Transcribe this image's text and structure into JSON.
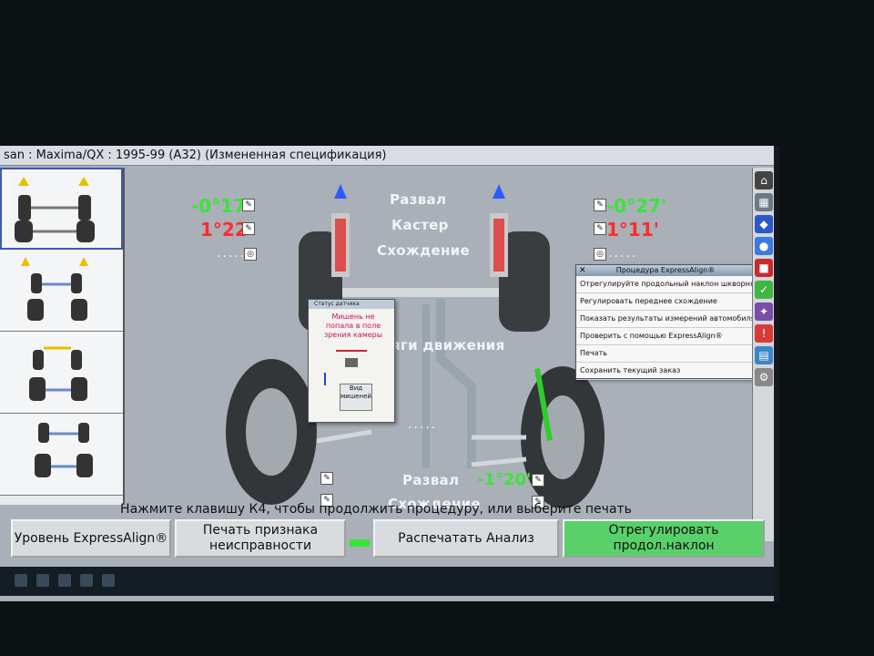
{
  "window": {
    "title": "san : Maxima/QX : 1995-99 (A32) (Измененная спецификация)"
  },
  "diagram": {
    "labels": {
      "camber": "Развал",
      "caster": "Кастер",
      "toe": "Схождение",
      "thrust": "яги движения",
      "rear_camber": "Развал",
      "rear_toe": "Схождение"
    },
    "front_left": {
      "camber": "-0°17'",
      "caster": "1°22'"
    },
    "front_right": {
      "camber": "-0°27'",
      "caster": "1°11'"
    },
    "rear_right": {
      "camber": "-1°20'"
    },
    "dots": "....."
  },
  "expressalign_popup": {
    "title": "Процедура ExpressAlign®",
    "items": [
      "Отрегулируйте продольный наклон шкворня",
      "Регулировать переднее схождение",
      "Показать результаты измерений автомобиля",
      "Проверить с помощью ExpressAlign®",
      "Печать",
      "Сохранить текущий заказ"
    ]
  },
  "sensor_status": {
    "title": "Статус датчика",
    "message": "Мишень не попала в поле зрения камеры",
    "button": "Вид мишеней"
  },
  "hint": "Нажмите клавишу К4, чтобы продолжить процедуру, или выберите печать",
  "buttons": {
    "level": "Уровень ExpressAlign®",
    "print_fault": "Печать признака неисправности",
    "print_analysis": "Распечатать  Анализ",
    "adjust": "Отрегулировать продол.наклон"
  },
  "colors": {
    "positive": "#3de23a",
    "negative": "#ff2b2b",
    "primary_button": "#5ad06a"
  }
}
